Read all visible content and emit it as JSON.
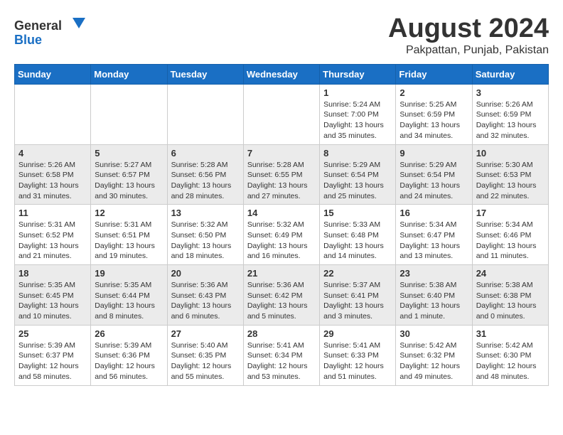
{
  "header": {
    "logo_general": "General",
    "logo_blue": "Blue",
    "month_title": "August 2024",
    "location": "Pakpattan, Punjab, Pakistan"
  },
  "calendar": {
    "days_of_week": [
      "Sunday",
      "Monday",
      "Tuesday",
      "Wednesday",
      "Thursday",
      "Friday",
      "Saturday"
    ],
    "weeks": [
      [
        {
          "day": "",
          "info": ""
        },
        {
          "day": "",
          "info": ""
        },
        {
          "day": "",
          "info": ""
        },
        {
          "day": "",
          "info": ""
        },
        {
          "day": "1",
          "info": "Sunrise: 5:24 AM\nSunset: 7:00 PM\nDaylight: 13 hours and 35 minutes."
        },
        {
          "day": "2",
          "info": "Sunrise: 5:25 AM\nSunset: 6:59 PM\nDaylight: 13 hours and 34 minutes."
        },
        {
          "day": "3",
          "info": "Sunrise: 5:26 AM\nSunset: 6:59 PM\nDaylight: 13 hours and 32 minutes."
        }
      ],
      [
        {
          "day": "4",
          "info": "Sunrise: 5:26 AM\nSunset: 6:58 PM\nDaylight: 13 hours and 31 minutes."
        },
        {
          "day": "5",
          "info": "Sunrise: 5:27 AM\nSunset: 6:57 PM\nDaylight: 13 hours and 30 minutes."
        },
        {
          "day": "6",
          "info": "Sunrise: 5:28 AM\nSunset: 6:56 PM\nDaylight: 13 hours and 28 minutes."
        },
        {
          "day": "7",
          "info": "Sunrise: 5:28 AM\nSunset: 6:55 PM\nDaylight: 13 hours and 27 minutes."
        },
        {
          "day": "8",
          "info": "Sunrise: 5:29 AM\nSunset: 6:54 PM\nDaylight: 13 hours and 25 minutes."
        },
        {
          "day": "9",
          "info": "Sunrise: 5:29 AM\nSunset: 6:54 PM\nDaylight: 13 hours and 24 minutes."
        },
        {
          "day": "10",
          "info": "Sunrise: 5:30 AM\nSunset: 6:53 PM\nDaylight: 13 hours and 22 minutes."
        }
      ],
      [
        {
          "day": "11",
          "info": "Sunrise: 5:31 AM\nSunset: 6:52 PM\nDaylight: 13 hours and 21 minutes."
        },
        {
          "day": "12",
          "info": "Sunrise: 5:31 AM\nSunset: 6:51 PM\nDaylight: 13 hours and 19 minutes."
        },
        {
          "day": "13",
          "info": "Sunrise: 5:32 AM\nSunset: 6:50 PM\nDaylight: 13 hours and 18 minutes."
        },
        {
          "day": "14",
          "info": "Sunrise: 5:32 AM\nSunset: 6:49 PM\nDaylight: 13 hours and 16 minutes."
        },
        {
          "day": "15",
          "info": "Sunrise: 5:33 AM\nSunset: 6:48 PM\nDaylight: 13 hours and 14 minutes."
        },
        {
          "day": "16",
          "info": "Sunrise: 5:34 AM\nSunset: 6:47 PM\nDaylight: 13 hours and 13 minutes."
        },
        {
          "day": "17",
          "info": "Sunrise: 5:34 AM\nSunset: 6:46 PM\nDaylight: 13 hours and 11 minutes."
        }
      ],
      [
        {
          "day": "18",
          "info": "Sunrise: 5:35 AM\nSunset: 6:45 PM\nDaylight: 13 hours and 10 minutes."
        },
        {
          "day": "19",
          "info": "Sunrise: 5:35 AM\nSunset: 6:44 PM\nDaylight: 13 hours and 8 minutes."
        },
        {
          "day": "20",
          "info": "Sunrise: 5:36 AM\nSunset: 6:43 PM\nDaylight: 13 hours and 6 minutes."
        },
        {
          "day": "21",
          "info": "Sunrise: 5:36 AM\nSunset: 6:42 PM\nDaylight: 13 hours and 5 minutes."
        },
        {
          "day": "22",
          "info": "Sunrise: 5:37 AM\nSunset: 6:41 PM\nDaylight: 13 hours and 3 minutes."
        },
        {
          "day": "23",
          "info": "Sunrise: 5:38 AM\nSunset: 6:40 PM\nDaylight: 13 hours and 1 minute."
        },
        {
          "day": "24",
          "info": "Sunrise: 5:38 AM\nSunset: 6:38 PM\nDaylight: 13 hours and 0 minutes."
        }
      ],
      [
        {
          "day": "25",
          "info": "Sunrise: 5:39 AM\nSunset: 6:37 PM\nDaylight: 12 hours and 58 minutes."
        },
        {
          "day": "26",
          "info": "Sunrise: 5:39 AM\nSunset: 6:36 PM\nDaylight: 12 hours and 56 minutes."
        },
        {
          "day": "27",
          "info": "Sunrise: 5:40 AM\nSunset: 6:35 PM\nDaylight: 12 hours and 55 minutes."
        },
        {
          "day": "28",
          "info": "Sunrise: 5:41 AM\nSunset: 6:34 PM\nDaylight: 12 hours and 53 minutes."
        },
        {
          "day": "29",
          "info": "Sunrise: 5:41 AM\nSunset: 6:33 PM\nDaylight: 12 hours and 51 minutes."
        },
        {
          "day": "30",
          "info": "Sunrise: 5:42 AM\nSunset: 6:32 PM\nDaylight: 12 hours and 49 minutes."
        },
        {
          "day": "31",
          "info": "Sunrise: 5:42 AM\nSunset: 6:30 PM\nDaylight: 12 hours and 48 minutes."
        }
      ]
    ]
  }
}
